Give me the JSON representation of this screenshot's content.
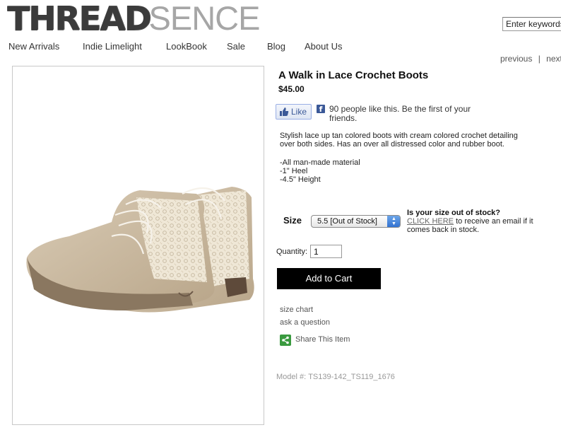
{
  "header": {
    "logo_part1": "THREAD",
    "logo_part2": "SENCE",
    "search_placeholder": "Enter keywords"
  },
  "nav": {
    "items": [
      "New Arrivals",
      "Indie Limelight",
      "LookBook",
      "Sale",
      "Blog",
      "About Us"
    ]
  },
  "pager": {
    "previous": "previous",
    "separator": "|",
    "next": "next"
  },
  "product": {
    "title": "A Walk in Lace Crochet Boots",
    "price": "$45.00",
    "like_button": "Like",
    "like_text": "90 people like this. Be the first of your friends.",
    "description": "Stylish lace up tan colored boots with cream colored crochet detailing over both sides. Has an over all distressed color and rubber boot.",
    "features": [
      "-All man-made material",
      "-1\" Heel",
      "-4.5\" Height"
    ],
    "size_label": "Size",
    "size_selected": "5.5 [Out of Stock]",
    "oos_question": "Is your size out of stock?",
    "oos_link": "CLICK HERE",
    "oos_text": " to receive an email if it comes back in stock.",
    "quantity_label": "Quantity:",
    "quantity_value": "1",
    "add_to_cart": "Add to Cart",
    "size_chart": "size chart",
    "ask_question": "ask a question",
    "share": "Share This Item",
    "model_label": "Model #:",
    "model_number": "TS139-142_TS119_1676"
  },
  "colors": {
    "brand_dark": "#3b3b3b",
    "brand_light": "#a6a6a6",
    "facebook": "#3b5998",
    "cart_button": "#000000",
    "share_green": "#3a9a3f"
  }
}
